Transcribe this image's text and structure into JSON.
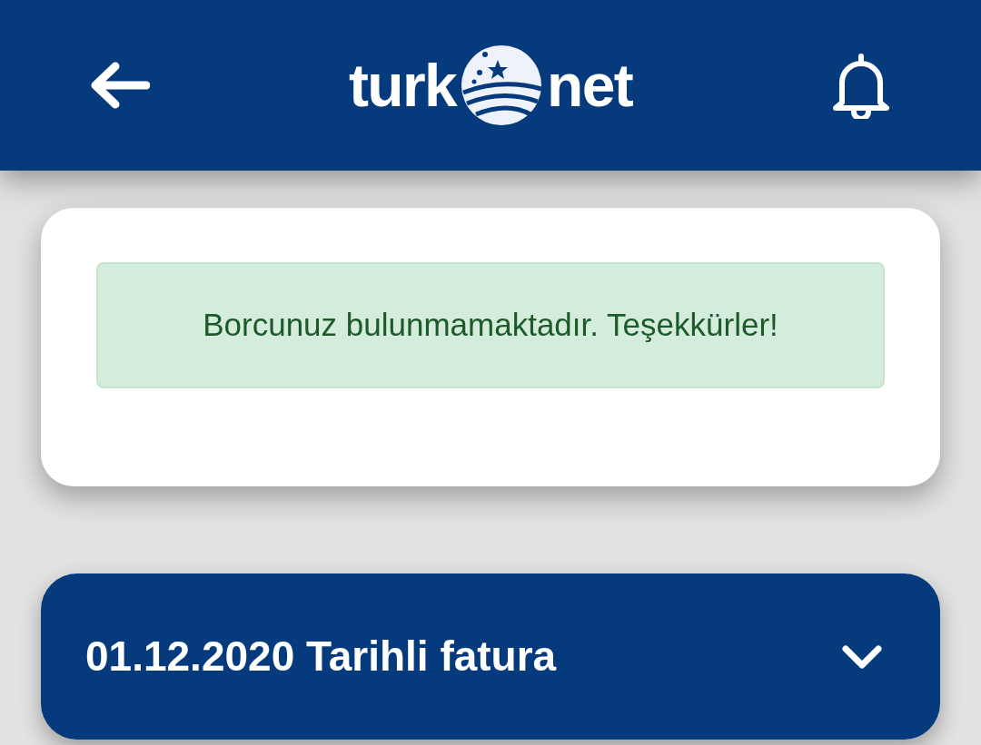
{
  "header": {
    "logo": {
      "left": "turk",
      "right": "net"
    }
  },
  "status_card": {
    "message": "Borcunuz bulunmamaktadır. Teşekkürler!"
  },
  "invoices": [
    {
      "title": "01.12.2020 Tarihli fatura",
      "expanded": false
    }
  ]
}
